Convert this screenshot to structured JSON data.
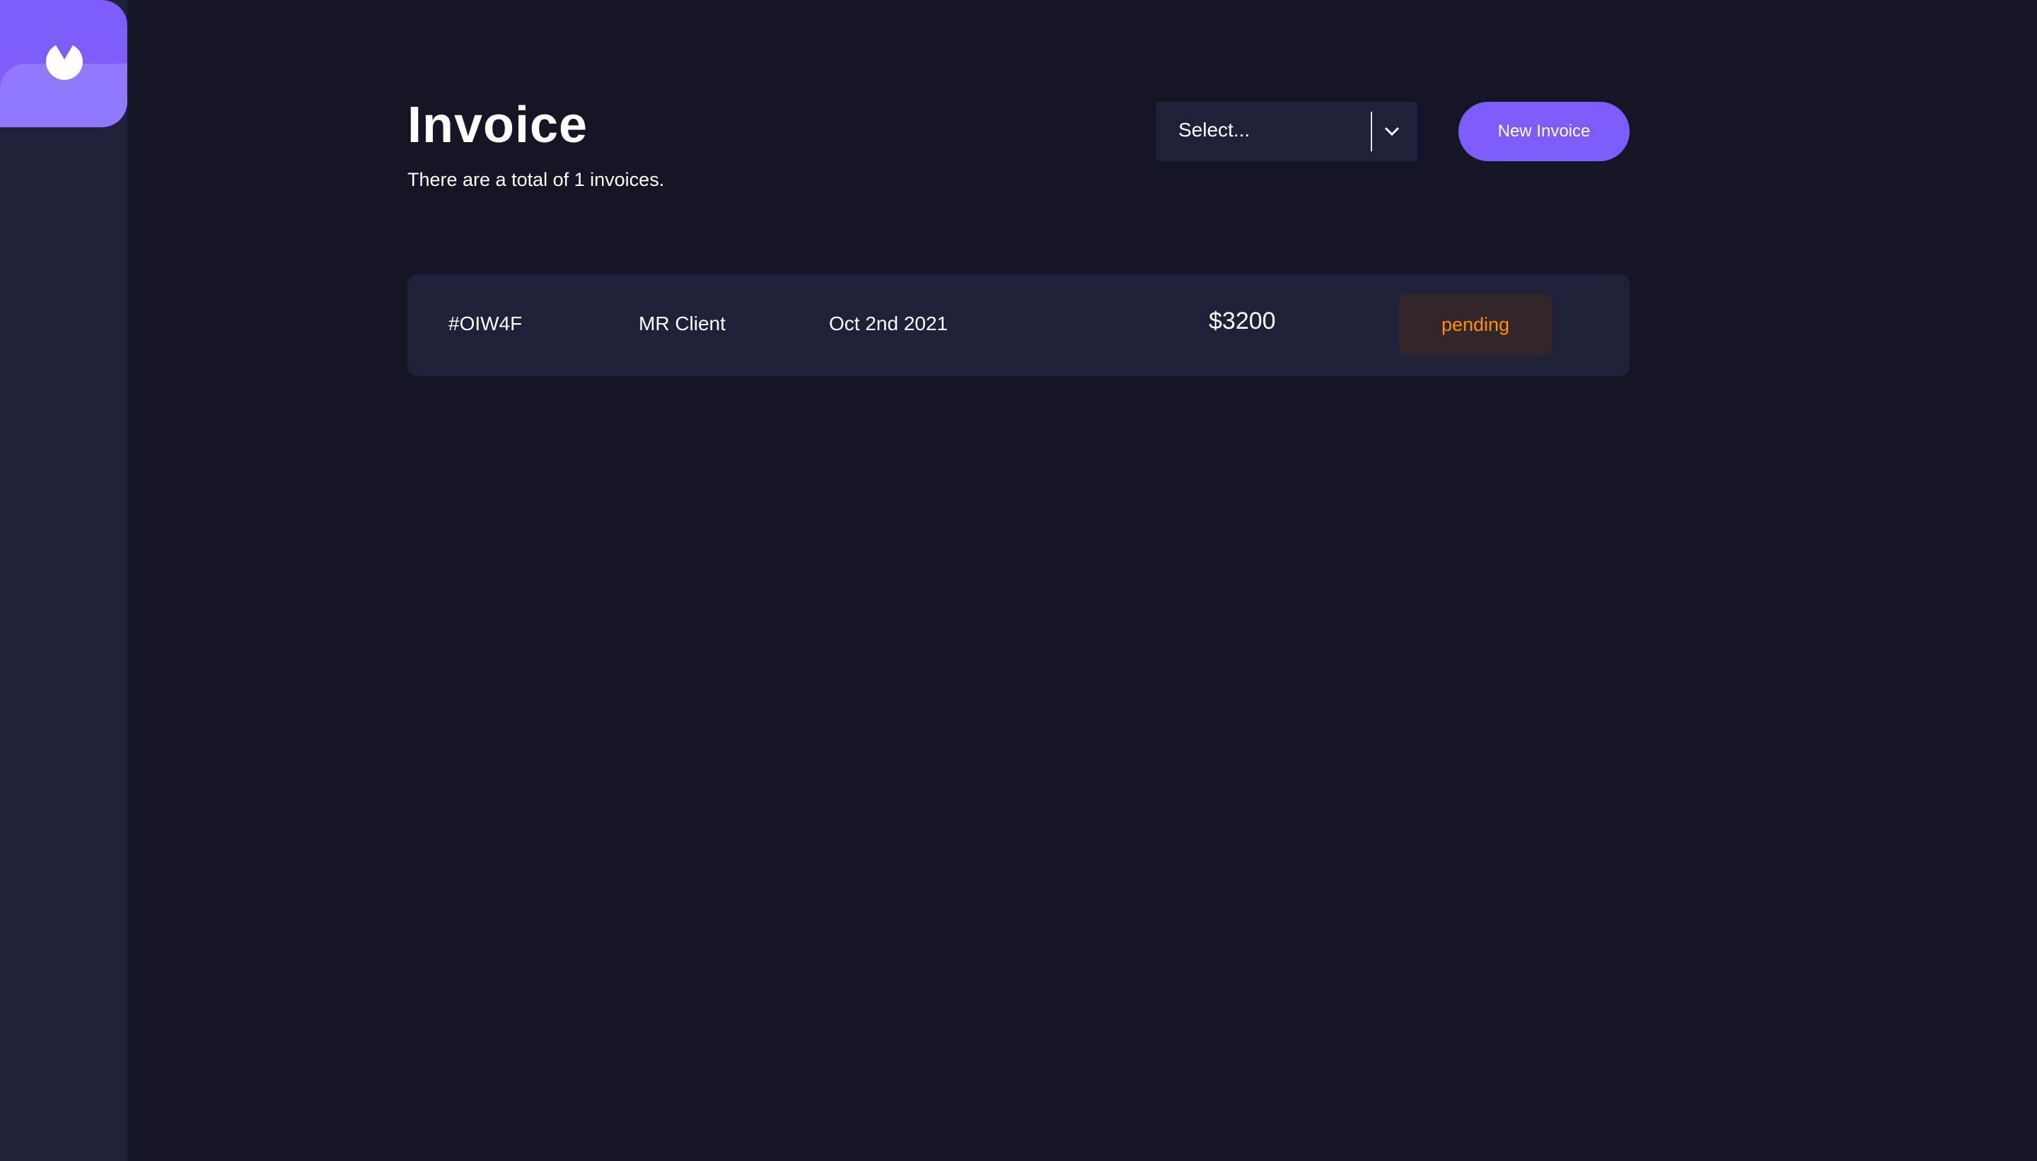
{
  "sidebar": {
    "logo_icon": "logo-mark-icon",
    "logo_color": "#7c5dfa"
  },
  "header": {
    "title": "Invoice",
    "subtitle": "There are a total of 1 invoices."
  },
  "filter": {
    "placeholder": "Select...",
    "chevron_icon": "chevron-down-icon"
  },
  "actions": {
    "new_invoice_label": "New Invoice",
    "accent_color": "#7c5dfa"
  },
  "invoices": [
    {
      "id": "#OIW4F",
      "client": "MR Client",
      "date": "Oct 2nd 2021",
      "amount": "$3200",
      "status": "pending",
      "status_color": "#ff8f00"
    }
  ]
}
